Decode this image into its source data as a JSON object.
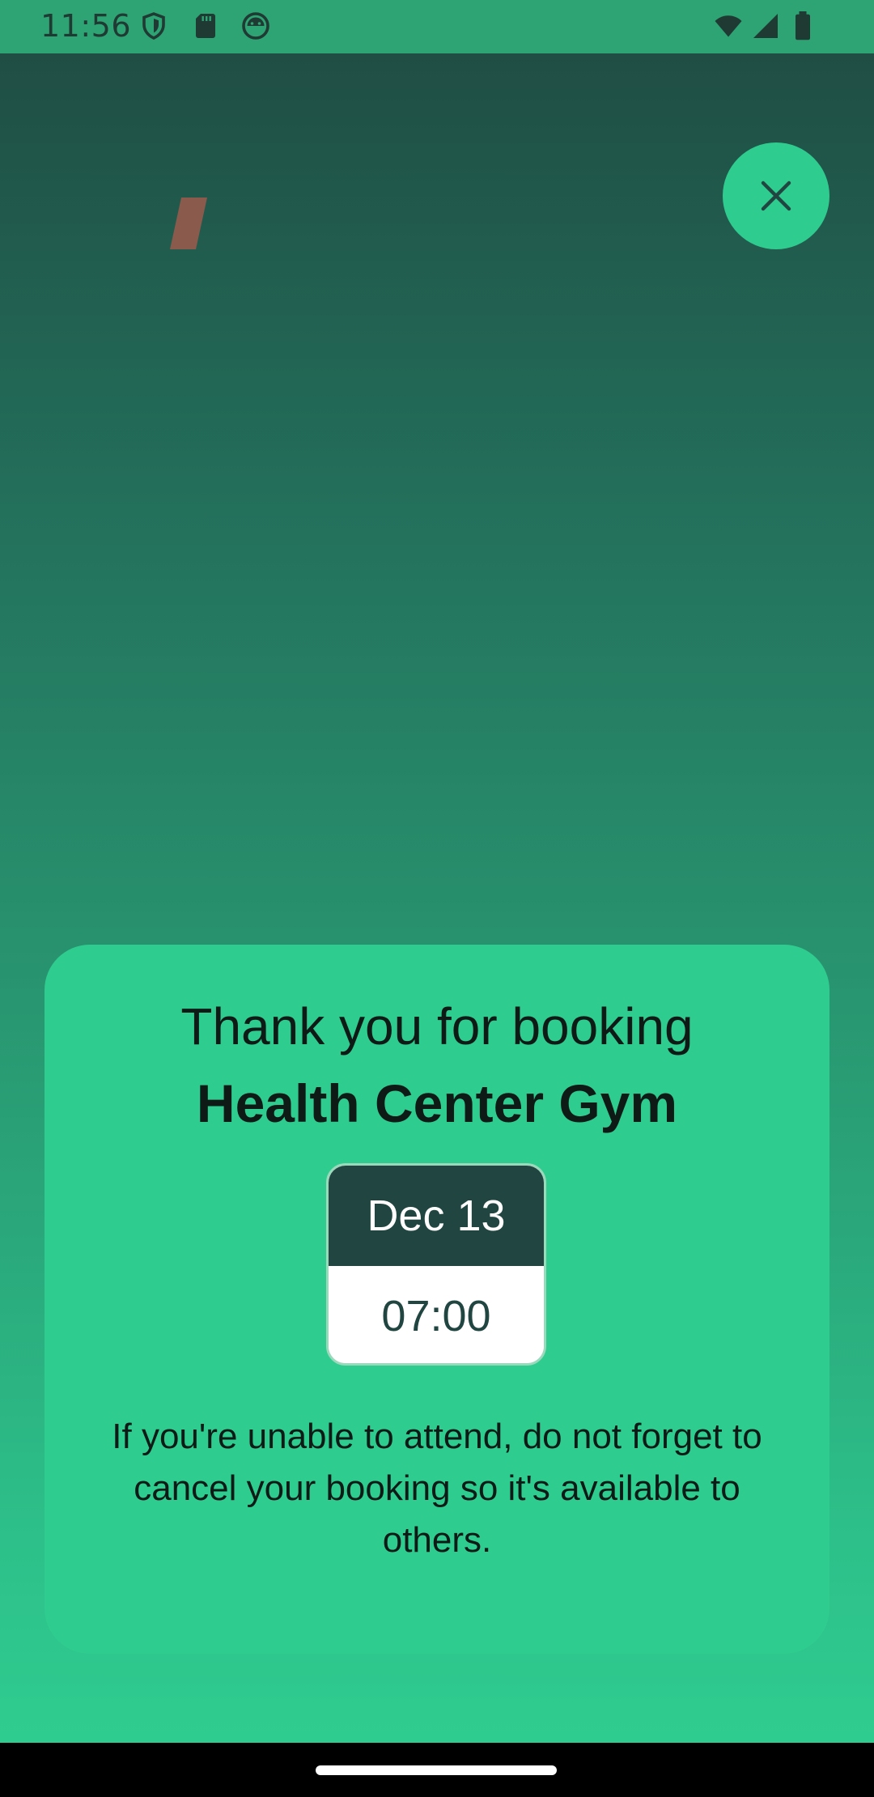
{
  "status_bar": {
    "time": "11:56",
    "icons_left": [
      "shield-icon",
      "sd-card-icon",
      "android-face-icon"
    ],
    "icons_right": [
      "wifi-icon",
      "cellular-signal-icon",
      "battery-icon"
    ]
  },
  "close_button": {
    "icon": "close-icon",
    "color": "#2fcc8f"
  },
  "decoration": {
    "icon": "slash-shape",
    "color": "#8a5a4c"
  },
  "confirmation": {
    "heading": "Thank you for booking",
    "venue": "Health Center Gym",
    "date": "Dec 13",
    "time": "07:00",
    "note": "If you're unable to attend, do not forget to cancel your booking so it's available to others."
  },
  "colors": {
    "accent": "#2fcc8f",
    "dark": "#214540",
    "background_top": "#1f4a42"
  }
}
